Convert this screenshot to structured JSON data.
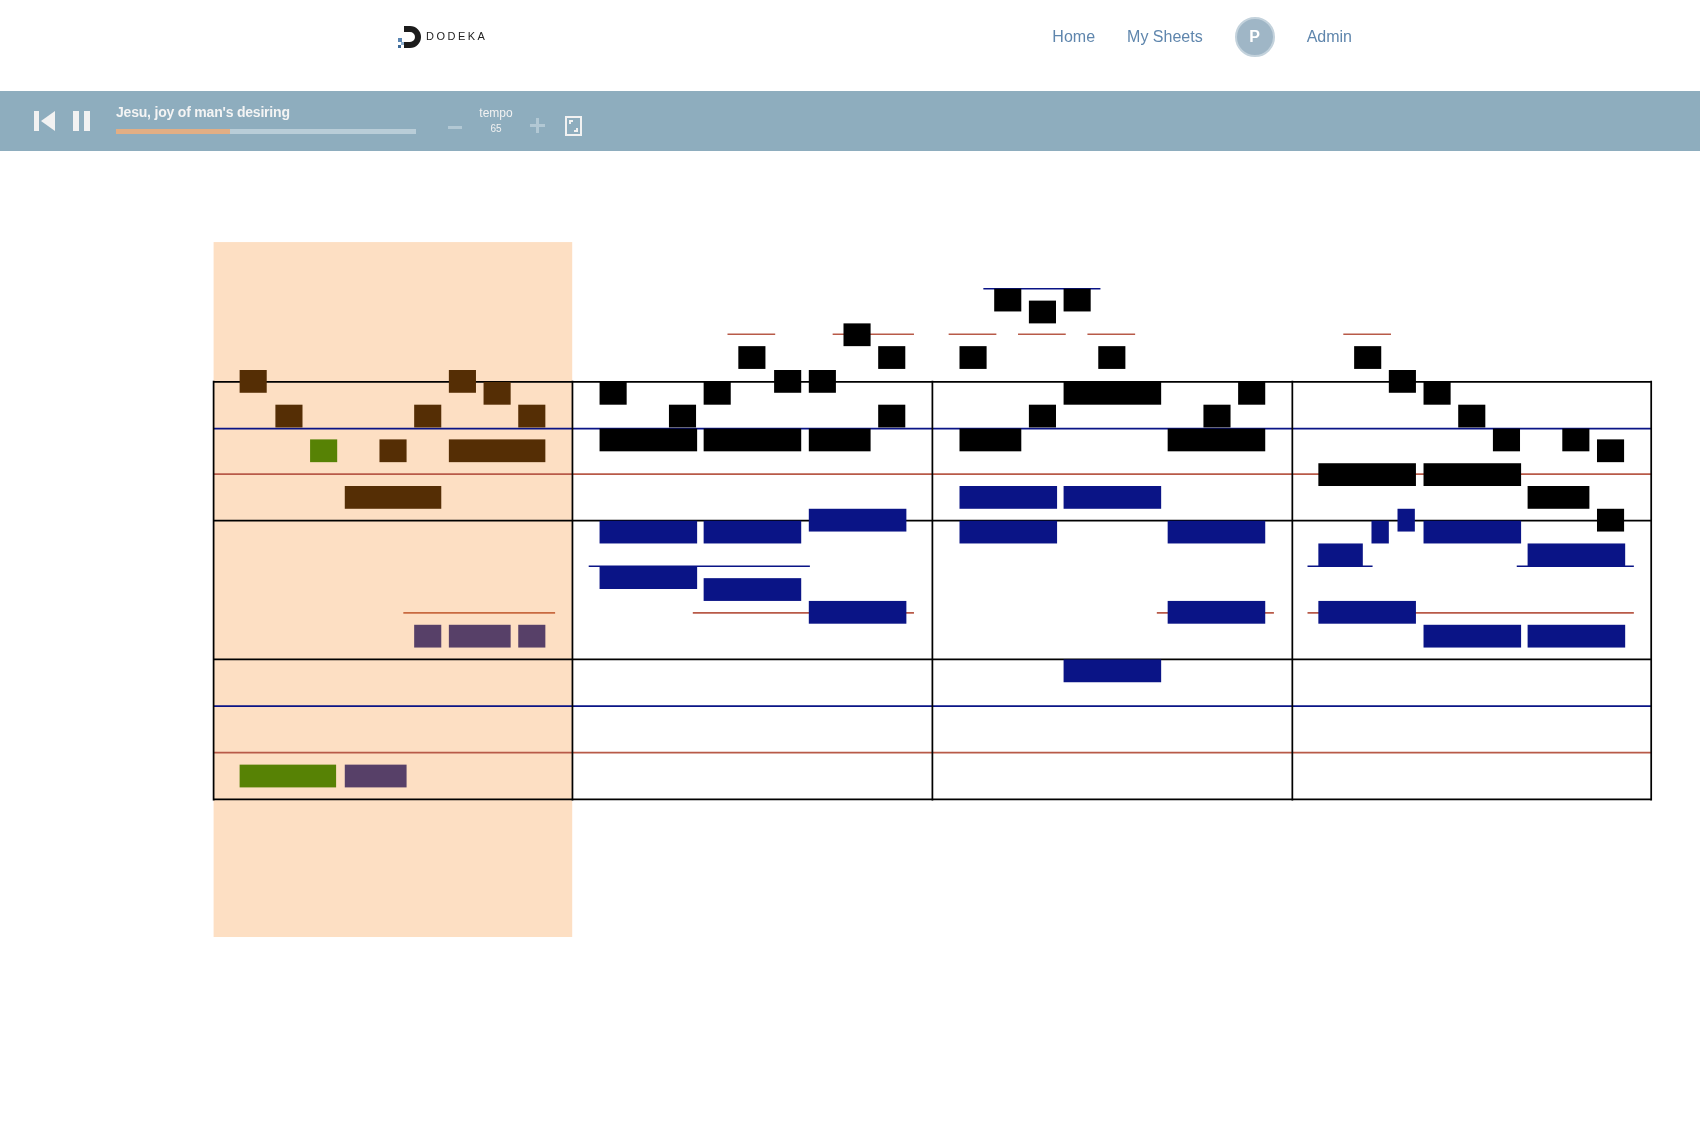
{
  "brand": {
    "name": "DODEKA"
  },
  "nav": [
    {
      "kind": "link",
      "label": "Home"
    },
    {
      "kind": "link",
      "label": "My Sheets"
    },
    {
      "kind": "avatar",
      "label": "P"
    },
    {
      "kind": "link",
      "label": "Admin"
    }
  ],
  "player": {
    "title": "Jesu, joy of man's desiring",
    "progress": {
      "level": 0.38
    },
    "tempo": {
      "label": "tempo",
      "value": "65"
    }
  },
  "score": {
    "measures": [
      {
        "highlighted": true
      },
      {
        "highlighted": false
      },
      {
        "highlighted": false
      },
      {
        "highlighted": false
      }
    ]
  }
}
